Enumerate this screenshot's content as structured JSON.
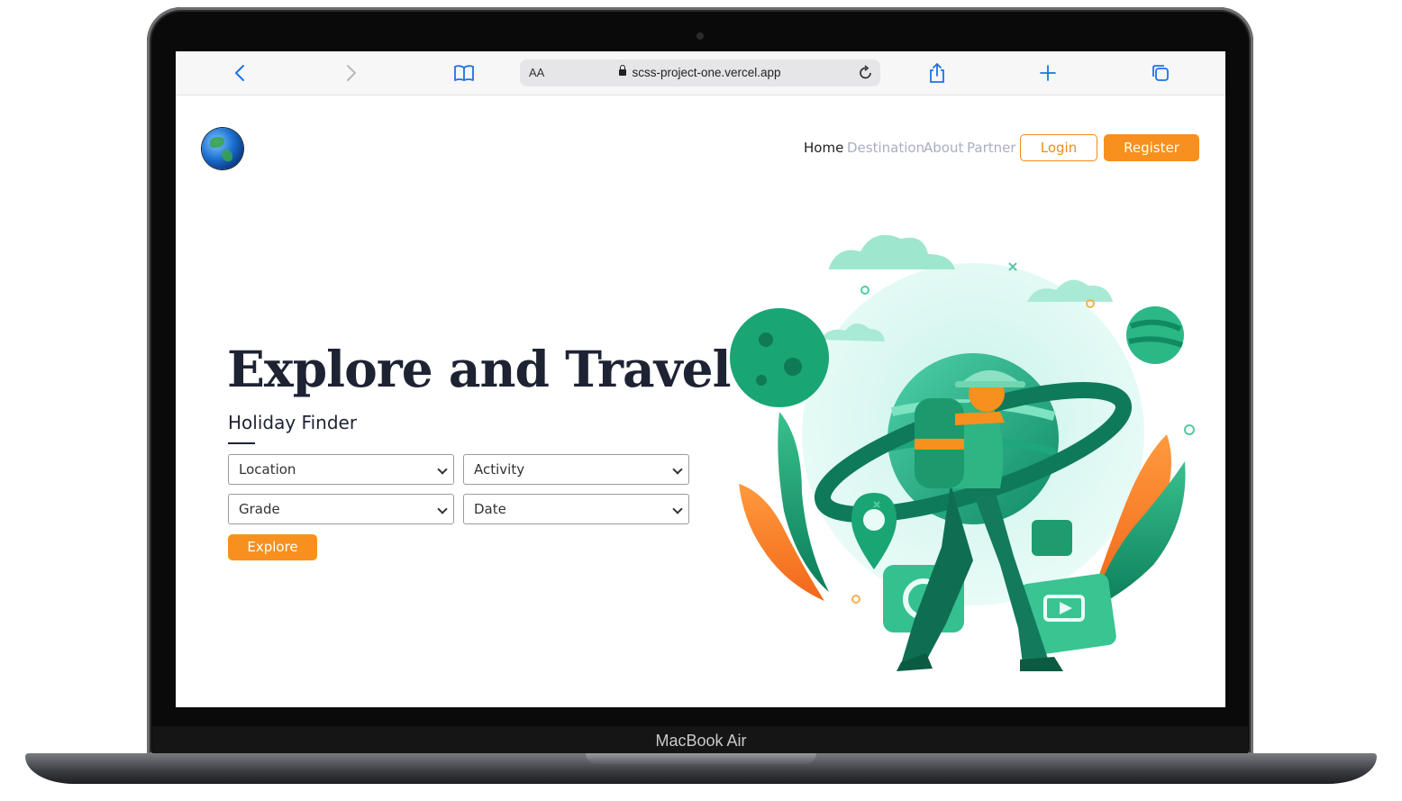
{
  "device": {
    "label": "MacBook Air"
  },
  "browser": {
    "text_size_label": "AA",
    "url": "scss-project-one.vercel.app",
    "icons": [
      "back-icon",
      "forward-icon",
      "bookmarks-icon",
      "lock-icon",
      "reload-icon",
      "share-icon",
      "new-tab-icon",
      "tabs-icon"
    ]
  },
  "nav": {
    "items": [
      "Home",
      "Destination",
      "About",
      "Partner"
    ],
    "login_label": "Login",
    "register_label": "Register"
  },
  "hero": {
    "title": "Explore and Travel",
    "subtitle": "Holiday Finder",
    "filters": {
      "location": "Location",
      "activity": "Activity",
      "grade": "Grade",
      "date": "Date"
    },
    "explore_label": "Explore"
  },
  "colors": {
    "accent": "#f7901e",
    "nav_muted": "#a9aec4",
    "heading": "#1e2333",
    "browser_blue": "#1a73e8"
  }
}
